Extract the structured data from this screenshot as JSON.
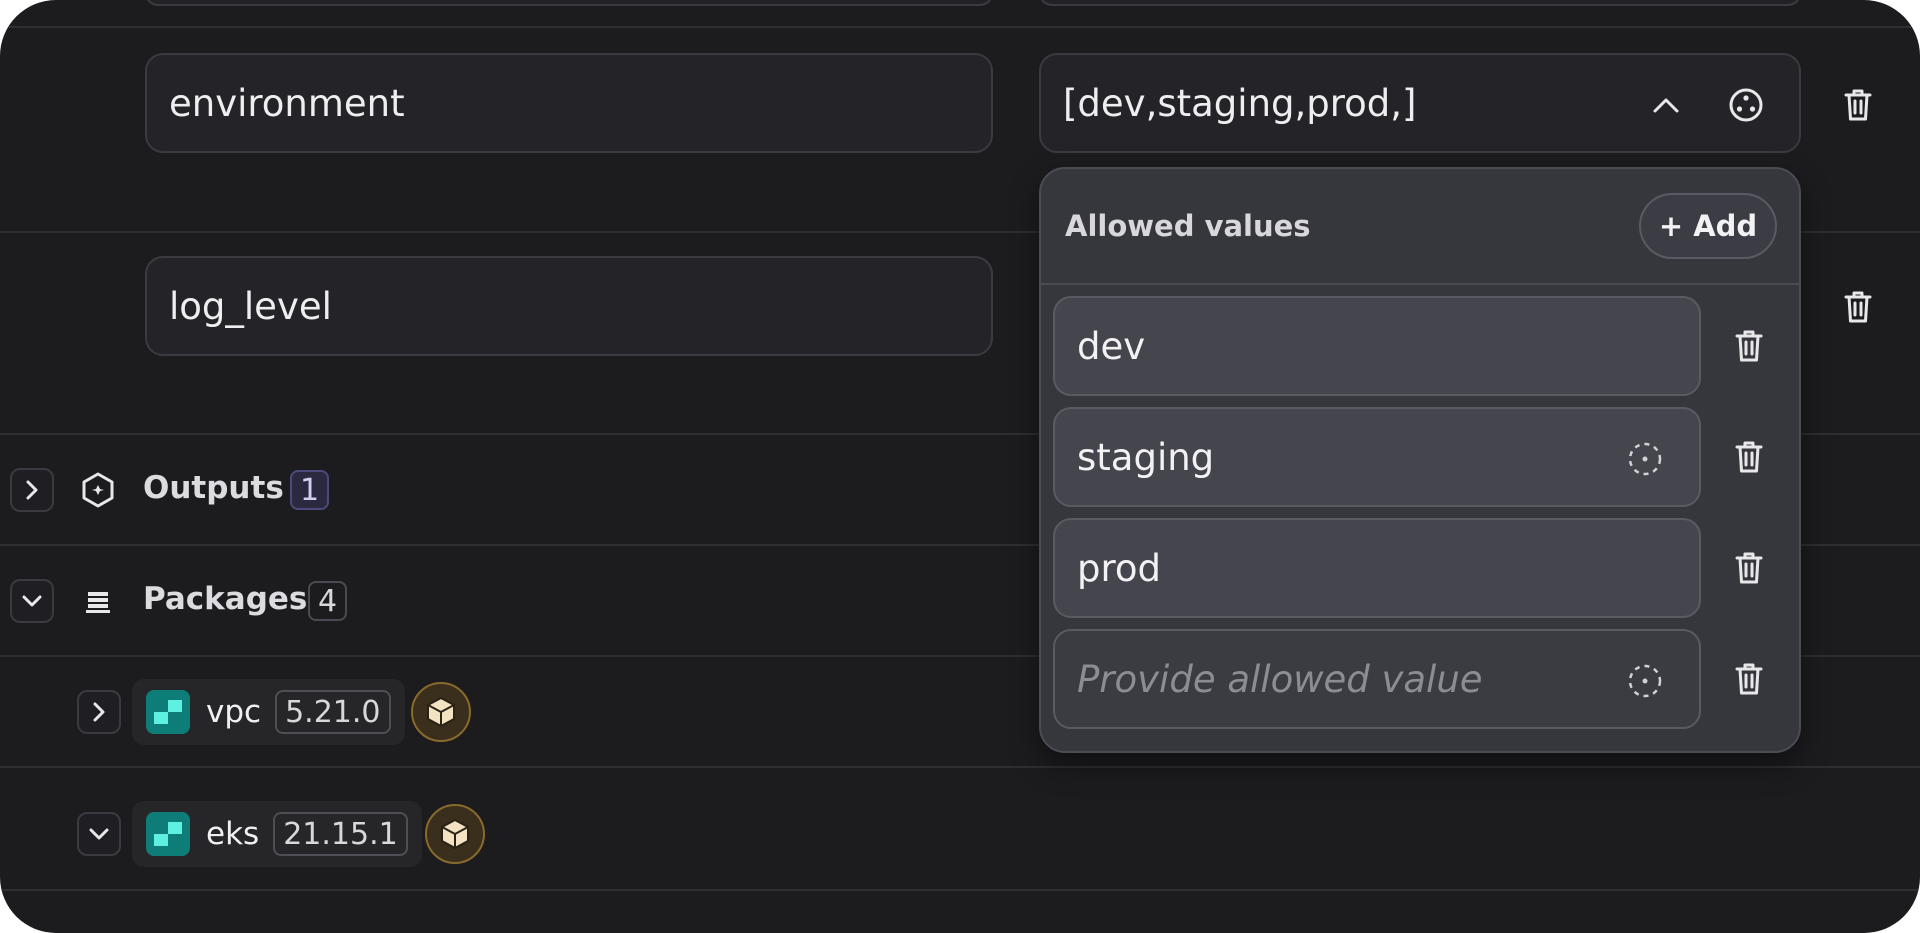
{
  "variables": [
    {
      "name": "environment",
      "value": "[dev,staging,prod,]"
    },
    {
      "name": "log_level",
      "value": ""
    }
  ],
  "popover": {
    "title": "Allowed values",
    "add_label": "+ Add",
    "values": [
      "dev",
      "staging",
      "prod"
    ],
    "placeholder": "Provide allowed value"
  },
  "sections": {
    "outputs": {
      "label": "Outputs",
      "count": "1"
    },
    "packages": {
      "label": "Packages",
      "count": "4"
    }
  },
  "packages": [
    {
      "name": "vpc",
      "version": "5.21.0"
    },
    {
      "name": "eks",
      "version": "21.15.1"
    }
  ],
  "colors": {
    "background": "#1c1c1f",
    "popover": "#36363d",
    "package_logo": "#0e7d78",
    "outputs_badge": "#2a2940"
  }
}
